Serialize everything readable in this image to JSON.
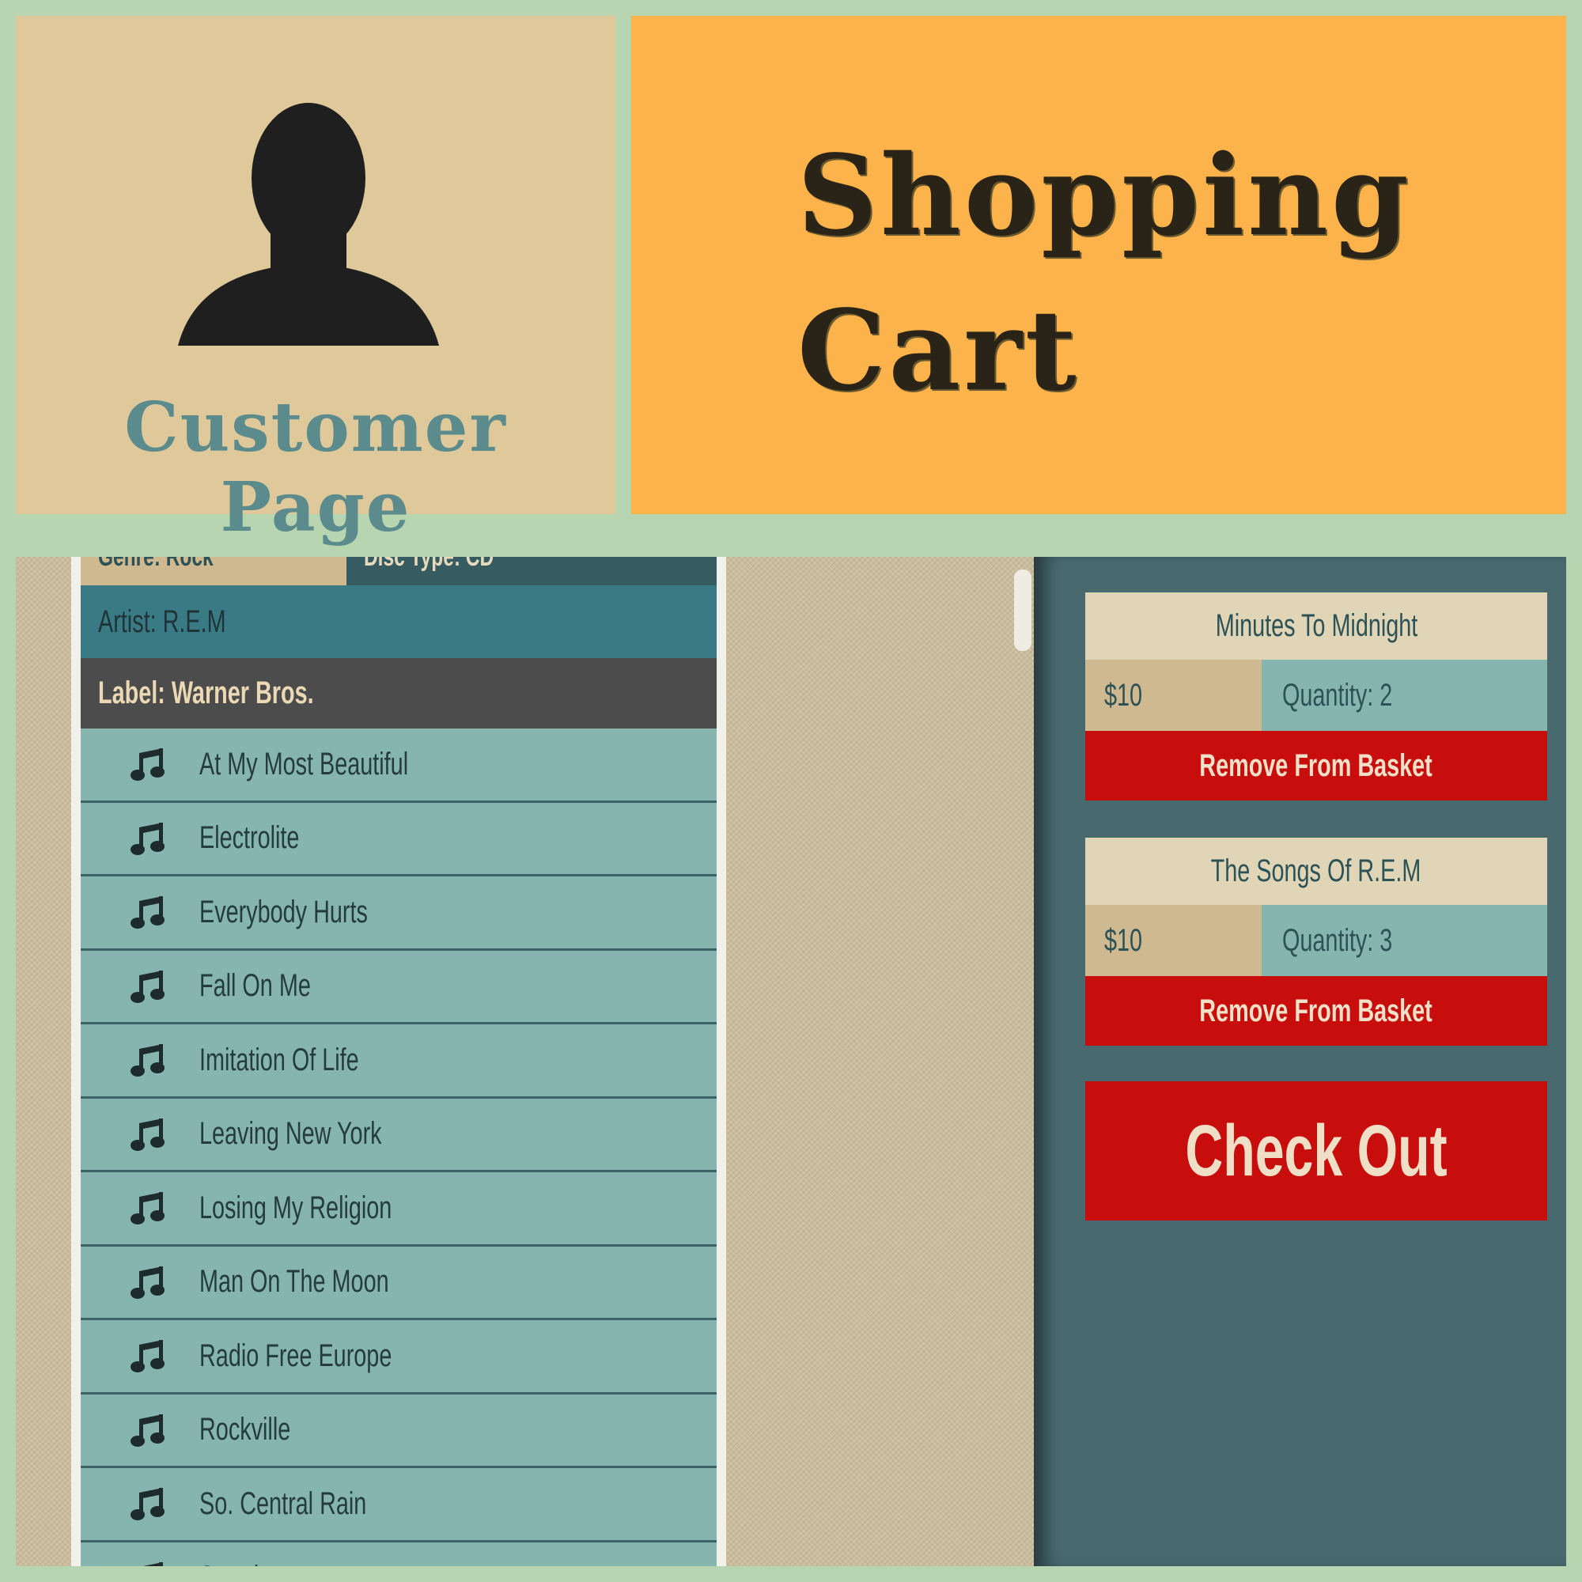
{
  "customer_panel": {
    "title": "Customer Page",
    "icon": "person-silhouette-icon"
  },
  "cart_panel": {
    "title_line1": "Shopping",
    "title_line2": "Cart"
  },
  "album": {
    "genre": "Genre: Rock",
    "disc_type": "Disc Type: CD",
    "artist": "Artist: R.E.M",
    "label": "Label: Warner Bros."
  },
  "songs": [
    "At My Most Beautiful",
    "Electrolite",
    "Everybody Hurts",
    "Fall On Me",
    "Imitation Of Life",
    "Leaving New York",
    "Losing My Religion",
    "Man On The Moon",
    "Radio Free Europe",
    "Rockville",
    "So. Central Rain",
    "Stand"
  ],
  "basket": [
    {
      "title": "Minutes To Midnight",
      "price": "$10",
      "quantity": "Quantity: 2",
      "remove_label": "Remove From Basket"
    },
    {
      "title": "The Songs Of R.E.M",
      "price": "$10",
      "quantity": "Quantity: 3",
      "remove_label": "Remove From Basket"
    }
  ],
  "checkout_label": "Check Out",
  "colors": {
    "background": "#b7d5b0",
    "customer": "#dfc99b",
    "cart": "#fdb34b",
    "sidebar": "#486a6f",
    "danger": "#c80d0d",
    "list": "#86b4af"
  }
}
